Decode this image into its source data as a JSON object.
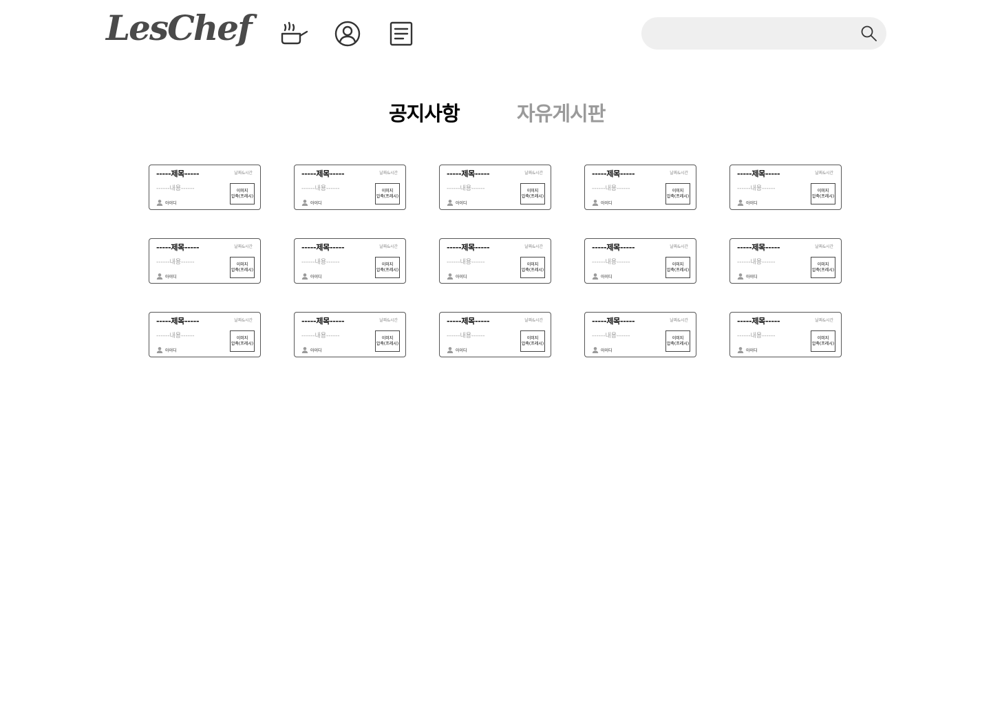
{
  "header": {
    "logo": "LesChef",
    "nav": [
      {
        "icon": "cooking-pot-icon"
      },
      {
        "icon": "user-circle-icon"
      },
      {
        "icon": "document-list-icon"
      }
    ],
    "search": {
      "value": "",
      "placeholder": "",
      "icon": "search-icon"
    }
  },
  "tabs": [
    {
      "label": "공지사항",
      "active": true
    },
    {
      "label": "자유게시판",
      "active": false
    }
  ],
  "colors": {
    "active_tab": "#000000",
    "inactive_tab": "#9a9a9a",
    "search_bg": "#efefef",
    "logo": "#4a4a4a"
  },
  "cards": [
    {
      "title": "-----제목-----",
      "date": "날짜&시간",
      "content": "------내용------",
      "thumb": [
        "이미지",
        "압축(프레시)"
      ],
      "author": "아이디"
    },
    {
      "title": "-----제목-----",
      "date": "날짜&시간",
      "content": "------내용------",
      "thumb": [
        "이미지",
        "압축(프레시)"
      ],
      "author": "아이디"
    },
    {
      "title": "-----제목-----",
      "date": "날짜&시간",
      "content": "------내용------",
      "thumb": [
        "이미지",
        "압축(프레시)"
      ],
      "author": "아이디"
    },
    {
      "title": "-----제목-----",
      "date": "날짜&시간",
      "content": "------내용------",
      "thumb": [
        "이미지",
        "압축(프레시)"
      ],
      "author": "아이디"
    },
    {
      "title": "-----제목-----",
      "date": "날짜&시간",
      "content": "------내용------",
      "thumb": [
        "이미지",
        "압축(프레시)"
      ],
      "author": "아이디"
    },
    {
      "title": "-----제목-----",
      "date": "날짜&시간",
      "content": "------내용------",
      "thumb": [
        "이미지",
        "압축(프레시)"
      ],
      "author": "아이디"
    },
    {
      "title": "-----제목-----",
      "date": "날짜&시간",
      "content": "------내용------",
      "thumb": [
        "이미지",
        "압축(프레시)"
      ],
      "author": "아이디"
    },
    {
      "title": "-----제목-----",
      "date": "날짜&시간",
      "content": "------내용------",
      "thumb": [
        "이미지",
        "압축(프레시)"
      ],
      "author": "아이디"
    },
    {
      "title": "-----제목-----",
      "date": "날짜&시간",
      "content": "------내용------",
      "thumb": [
        "이미지",
        "압축(프레시)"
      ],
      "author": "아이디"
    },
    {
      "title": "-----제목-----",
      "date": "날짜&시간",
      "content": "------내용------",
      "thumb": [
        "이미지",
        "압축(프레시)"
      ],
      "author": "아이디"
    },
    {
      "title": "-----제목-----",
      "date": "날짜&시간",
      "content": "------내용------",
      "thumb": [
        "이미지",
        "압축(프레시)"
      ],
      "author": "아이디"
    },
    {
      "title": "-----제목-----",
      "date": "날짜&시간",
      "content": "------내용------",
      "thumb": [
        "이미지",
        "압축(프레시)"
      ],
      "author": "아이디"
    },
    {
      "title": "-----제목-----",
      "date": "날짜&시간",
      "content": "------내용------",
      "thumb": [
        "이미지",
        "압축(프레시)"
      ],
      "author": "아이디"
    },
    {
      "title": "-----제목-----",
      "date": "날짜&시간",
      "content": "------내용------",
      "thumb": [
        "이미지",
        "압축(프레시)"
      ],
      "author": "아이디"
    },
    {
      "title": "-----제목-----",
      "date": "날짜&시간",
      "content": "------내용------",
      "thumb": [
        "이미지",
        "압축(프레시)"
      ],
      "author": "아이디"
    }
  ]
}
